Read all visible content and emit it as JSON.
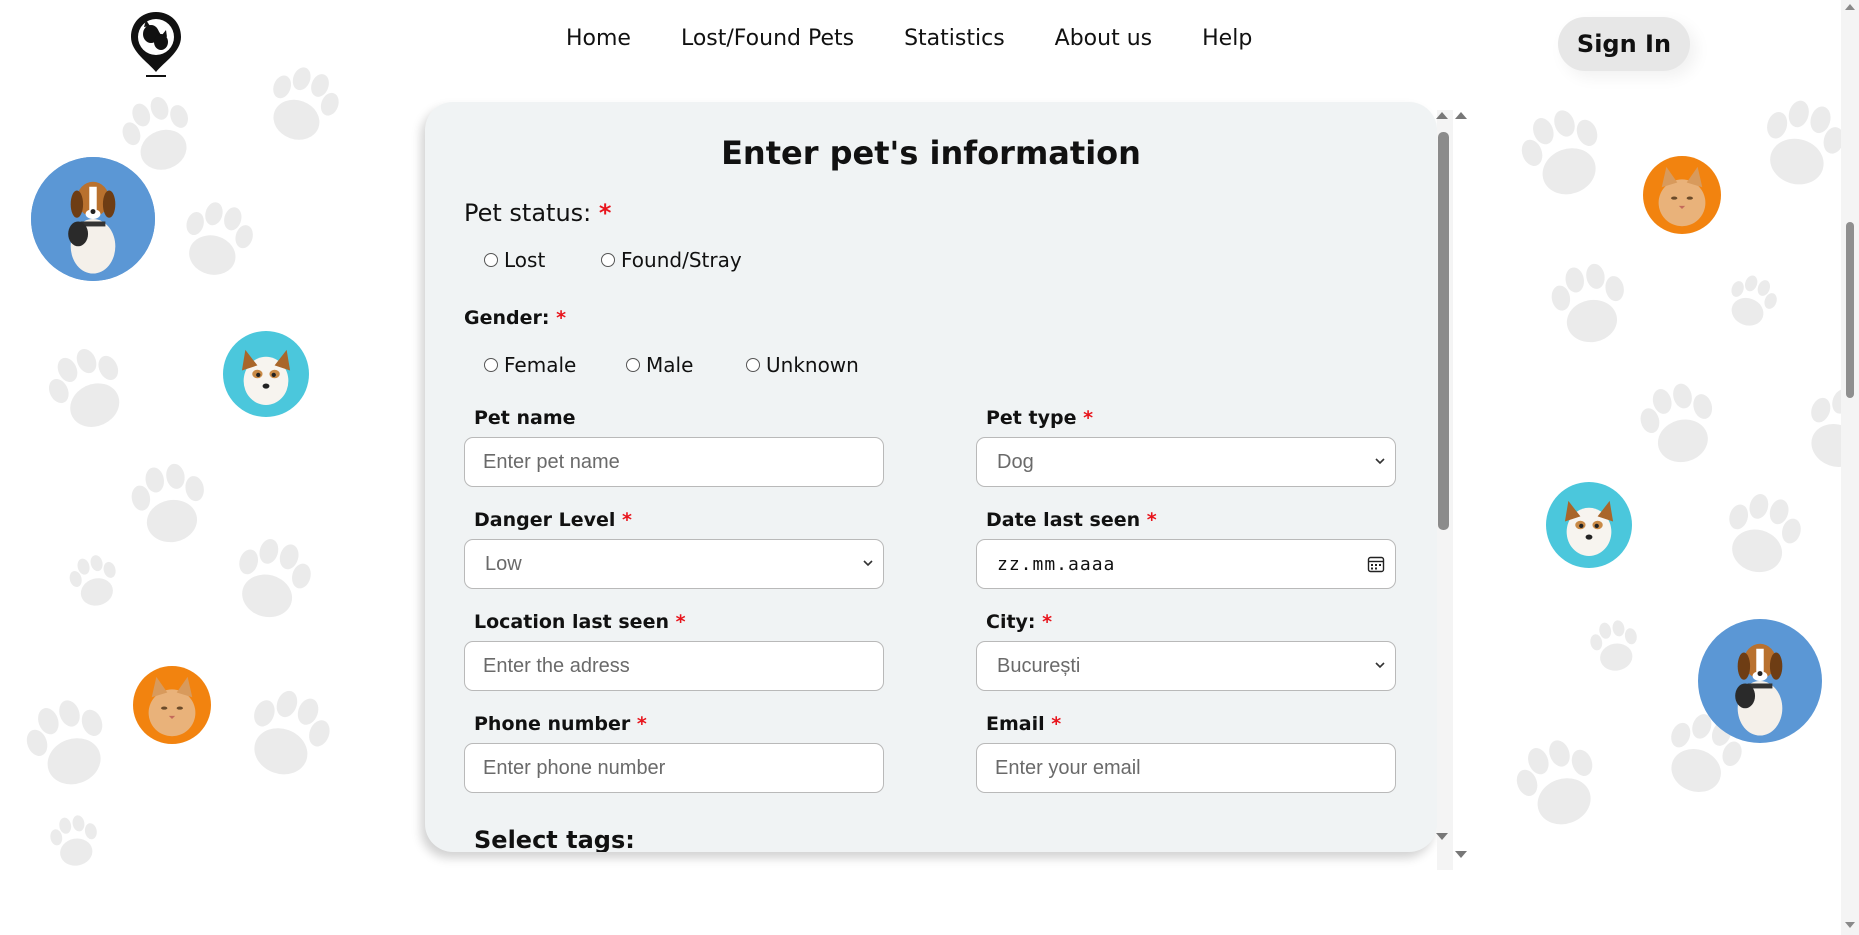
{
  "nav": {
    "items": [
      "Home",
      "Lost/Found Pets",
      "Statistics",
      "About us",
      "Help"
    ],
    "sign_in": "Sign In"
  },
  "form": {
    "title": "Enter pet's information",
    "required_mark": "*",
    "pet_status": {
      "label": "Pet status:",
      "options": [
        "Lost",
        "Found/Stray"
      ]
    },
    "gender": {
      "label": "Gender:",
      "options": [
        "Female",
        "Male",
        "Unknown"
      ]
    },
    "pet_name": {
      "label": "Pet name",
      "placeholder": "Enter pet name"
    },
    "pet_type": {
      "label": "Pet type",
      "value": "Dog"
    },
    "danger_level": {
      "label": "Danger Level",
      "value": "Low"
    },
    "date_last_seen": {
      "label": "Date last seen",
      "value": "zz.mm.aaaa"
    },
    "location": {
      "label": "Location last seen",
      "placeholder": "Enter the adress"
    },
    "city": {
      "label": "City:",
      "value": "București"
    },
    "phone": {
      "label": "Phone number",
      "placeholder": "Enter phone number"
    },
    "email": {
      "label": "Email",
      "placeholder": "Enter your email"
    },
    "tags": {
      "label": "Select tags:"
    }
  },
  "colors": {
    "accent_required": "#e8141c",
    "card_bg": "#f0f3f4",
    "sign_in_bg": "#e7e7e7",
    "avatar_blue": "#5b97d5",
    "avatar_cyan": "#4bc7dc",
    "avatar_orange": "#f2830f"
  },
  "icons": {
    "logo": "pet-location-pin-icon",
    "dropdown": "chevron-down-icon",
    "calendar": "calendar-icon"
  }
}
